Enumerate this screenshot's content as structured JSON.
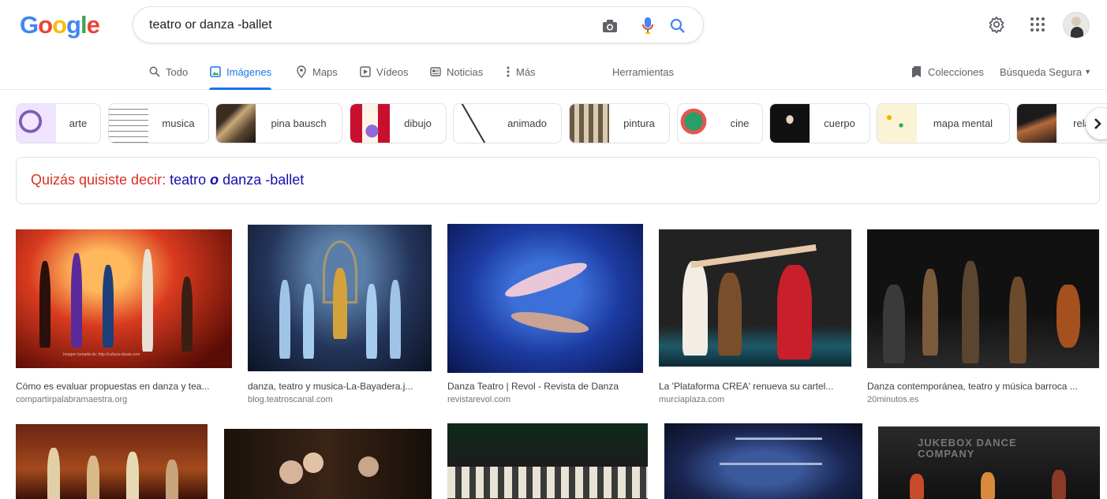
{
  "logo": {
    "letters": [
      "G",
      "o",
      "o",
      "g",
      "l",
      "e"
    ],
    "colors": [
      "#4285f4",
      "#ea4335",
      "#fbbc05",
      "#4285f4",
      "#34a853",
      "#ea4335"
    ]
  },
  "search": {
    "query": "teatro or danza -ballet"
  },
  "icons": {
    "camera": "camera-icon",
    "mic": "mic-icon",
    "search": "search-icon",
    "settings": "gear-icon",
    "apps": "apps-grid-icon"
  },
  "tabs": [
    {
      "label": "Todo",
      "icon": "search-icon"
    },
    {
      "label": "Imágenes",
      "icon": "image-icon",
      "active": true
    },
    {
      "label": "Maps",
      "icon": "map-pin-icon"
    },
    {
      "label": "Vídeos",
      "icon": "play-icon"
    },
    {
      "label": "Noticias",
      "icon": "news-icon"
    },
    {
      "label": "Más",
      "icon": "more-vert-icon"
    }
  ],
  "tools": {
    "herramientas": "Herramientas",
    "colecciones": "Colecciones",
    "safe_search": "Búsqueda Segura"
  },
  "chips": [
    {
      "label": "arte"
    },
    {
      "label": "musica"
    },
    {
      "label": "pina bausch"
    },
    {
      "label": "dibujo"
    },
    {
      "label": "animado"
    },
    {
      "label": "pintura"
    },
    {
      "label": "cine"
    },
    {
      "label": "cuerpo"
    },
    {
      "label": "mapa mental"
    },
    {
      "label": "rela"
    }
  ],
  "did_you_mean": {
    "prefix": "Quizás quisiste decir:",
    "part1": "teatro",
    "emph": "o",
    "part2": "danza -ballet"
  },
  "results_row1": [
    {
      "title": "Cómo es evaluar propuestas en danza y tea...",
      "source": "compartirpalabramaestra.org",
      "caption": "Imagen tomada de: http://cultura.elpais.com"
    },
    {
      "title": "danza, teatro y musica-La-Bayadera.j...",
      "source": "blog.teatroscanal.com"
    },
    {
      "title": "Danza Teatro | Revol - Revista de Danza",
      "source": "revistarevol.com"
    },
    {
      "title": "La 'Plataforma CREA' renueva su cartel...",
      "source": "murciaplaza.com"
    },
    {
      "title": "Danza contemporánea, teatro y música barroca ...",
      "source": "20minutos.es"
    }
  ],
  "results_row2": [
    {
      "alt": ""
    },
    {
      "alt": ""
    },
    {
      "alt": ""
    },
    {
      "alt": ""
    },
    {
      "overlay": "JUKEBOX DANCE COMPANY"
    }
  ]
}
